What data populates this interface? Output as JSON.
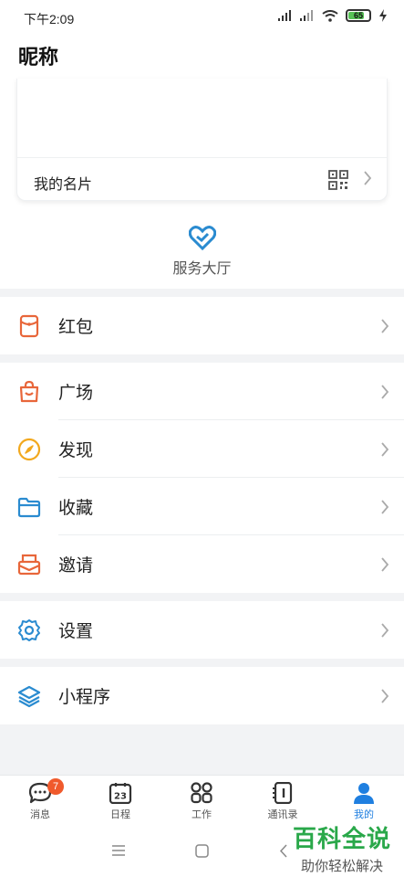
{
  "status_bar": {
    "time": "下午2:09",
    "battery": "65"
  },
  "header": {
    "title": "昵称"
  },
  "card": {
    "label": "我的名片"
  },
  "service_hall": {
    "label": "服务大厅"
  },
  "menu": {
    "red_packet": "红包",
    "plaza": "广场",
    "discover": "发现",
    "favorites": "收藏",
    "invite": "邀请",
    "settings": "设置",
    "mini_programs": "小程序"
  },
  "tabbar": {
    "messages": {
      "label": "消息",
      "badge": "7"
    },
    "calendar": {
      "label": "日程",
      "day": "23"
    },
    "work": {
      "label": "工作"
    },
    "contacts": {
      "label": "通讯录"
    },
    "me": {
      "label": "我的"
    }
  },
  "watermark": {
    "title": "百科全说",
    "subtitle": "助你轻松解决"
  },
  "colors": {
    "accent": "#1f7fe0",
    "orange": "#e8663a",
    "yellow": "#f2a81d",
    "blue": "#2a8bd0",
    "badge": "#f05a2c"
  }
}
